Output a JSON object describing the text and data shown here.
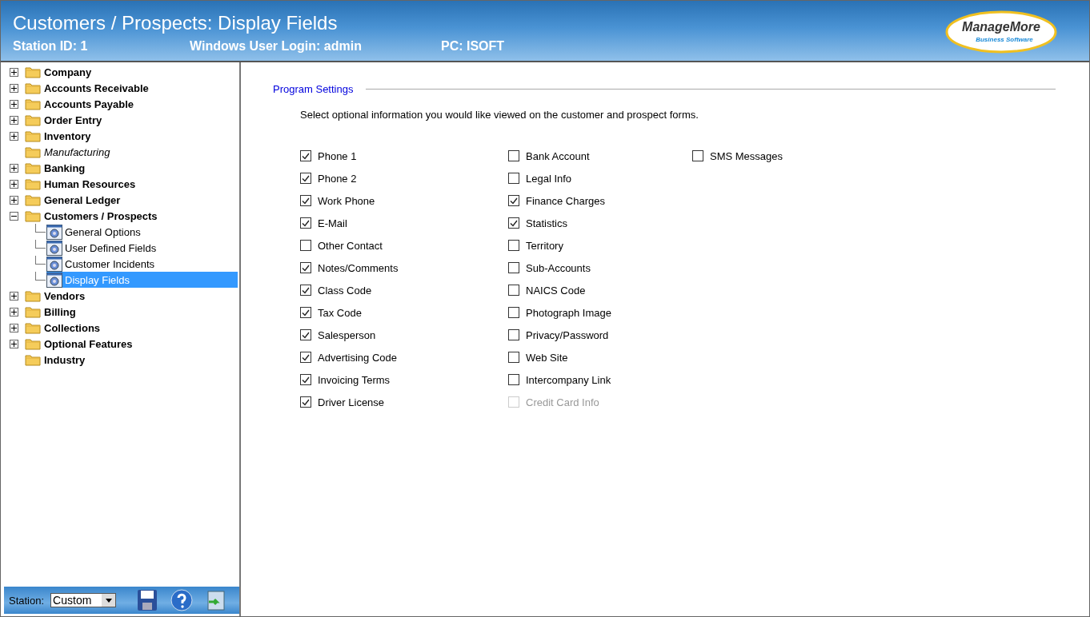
{
  "header": {
    "title": "Customers / Prospects: Display Fields",
    "station_id": "Station ID: 1",
    "user_login": "Windows User Login: admin",
    "pc": "PC: ISOFT",
    "logo": {
      "name": "ManageMore",
      "tagline": "Business Software"
    }
  },
  "tree": [
    {
      "label": "Company",
      "kind": "collapsed",
      "disabled": false
    },
    {
      "label": "Accounts Receivable",
      "kind": "collapsed",
      "disabled": false
    },
    {
      "label": "Accounts Payable",
      "kind": "collapsed",
      "disabled": false
    },
    {
      "label": "Order Entry",
      "kind": "collapsed",
      "disabled": false
    },
    {
      "label": "Inventory",
      "kind": "collapsed",
      "disabled": false
    },
    {
      "label": "Manufacturing",
      "kind": "leaf",
      "disabled": true
    },
    {
      "label": "Banking",
      "kind": "collapsed",
      "disabled": false
    },
    {
      "label": "Human Resources",
      "kind": "collapsed",
      "disabled": false
    },
    {
      "label": "General Ledger",
      "kind": "collapsed",
      "disabled": false
    },
    {
      "label": "Customers / Prospects",
      "kind": "expanded",
      "disabled": false,
      "children": [
        {
          "label": "General Options",
          "selected": false
        },
        {
          "label": "User Defined Fields",
          "selected": false
        },
        {
          "label": "Customer Incidents",
          "selected": false
        },
        {
          "label": "Display Fields",
          "selected": true
        }
      ]
    },
    {
      "label": "Vendors",
      "kind": "collapsed",
      "disabled": false
    },
    {
      "label": "Billing",
      "kind": "collapsed",
      "disabled": false
    },
    {
      "label": "Collections",
      "kind": "collapsed",
      "disabled": false
    },
    {
      "label": "Optional Features",
      "kind": "collapsed",
      "disabled": false
    },
    {
      "label": "Industry",
      "kind": "leaf",
      "disabled": false
    }
  ],
  "station_bar": {
    "label": "Station:",
    "value": "Custom"
  },
  "settings": {
    "group_title": "Program Settings",
    "instructions": "Select optional information you would like viewed on the customer and prospect forms.",
    "columns": [
      [
        {
          "label": "Phone 1",
          "checked": true,
          "disabled": false
        },
        {
          "label": "Phone 2",
          "checked": true,
          "disabled": false
        },
        {
          "label": "Work Phone",
          "checked": true,
          "disabled": false
        },
        {
          "label": "E-Mail",
          "checked": true,
          "disabled": false
        },
        {
          "label": "Other Contact",
          "checked": false,
          "disabled": false
        },
        {
          "label": "Notes/Comments",
          "checked": true,
          "disabled": false
        },
        {
          "label": "Class Code",
          "checked": true,
          "disabled": false
        },
        {
          "label": "Tax Code",
          "checked": true,
          "disabled": false
        },
        {
          "label": "Salesperson",
          "checked": true,
          "disabled": false
        },
        {
          "label": "Advertising Code",
          "checked": true,
          "disabled": false
        },
        {
          "label": "Invoicing Terms",
          "checked": true,
          "disabled": false
        },
        {
          "label": "Driver License",
          "checked": true,
          "disabled": false
        }
      ],
      [
        {
          "label": "Bank Account",
          "checked": false,
          "disabled": false
        },
        {
          "label": "Legal Info",
          "checked": false,
          "disabled": false
        },
        {
          "label": "Finance Charges",
          "checked": true,
          "disabled": false
        },
        {
          "label": "Statistics",
          "checked": true,
          "disabled": false
        },
        {
          "label": "Territory",
          "checked": false,
          "disabled": false
        },
        {
          "label": "Sub-Accounts",
          "checked": false,
          "disabled": false
        },
        {
          "label": "NAICS Code",
          "checked": false,
          "disabled": false
        },
        {
          "label": "Photograph Image",
          "checked": false,
          "disabled": false
        },
        {
          "label": "Privacy/Password",
          "checked": false,
          "disabled": false
        },
        {
          "label": "Web Site",
          "checked": false,
          "disabled": false
        },
        {
          "label": "Intercompany Link",
          "checked": false,
          "disabled": false
        },
        {
          "label": "Credit Card Info",
          "checked": false,
          "disabled": true
        }
      ],
      [
        {
          "label": "SMS Messages",
          "checked": false,
          "disabled": false
        }
      ]
    ]
  }
}
